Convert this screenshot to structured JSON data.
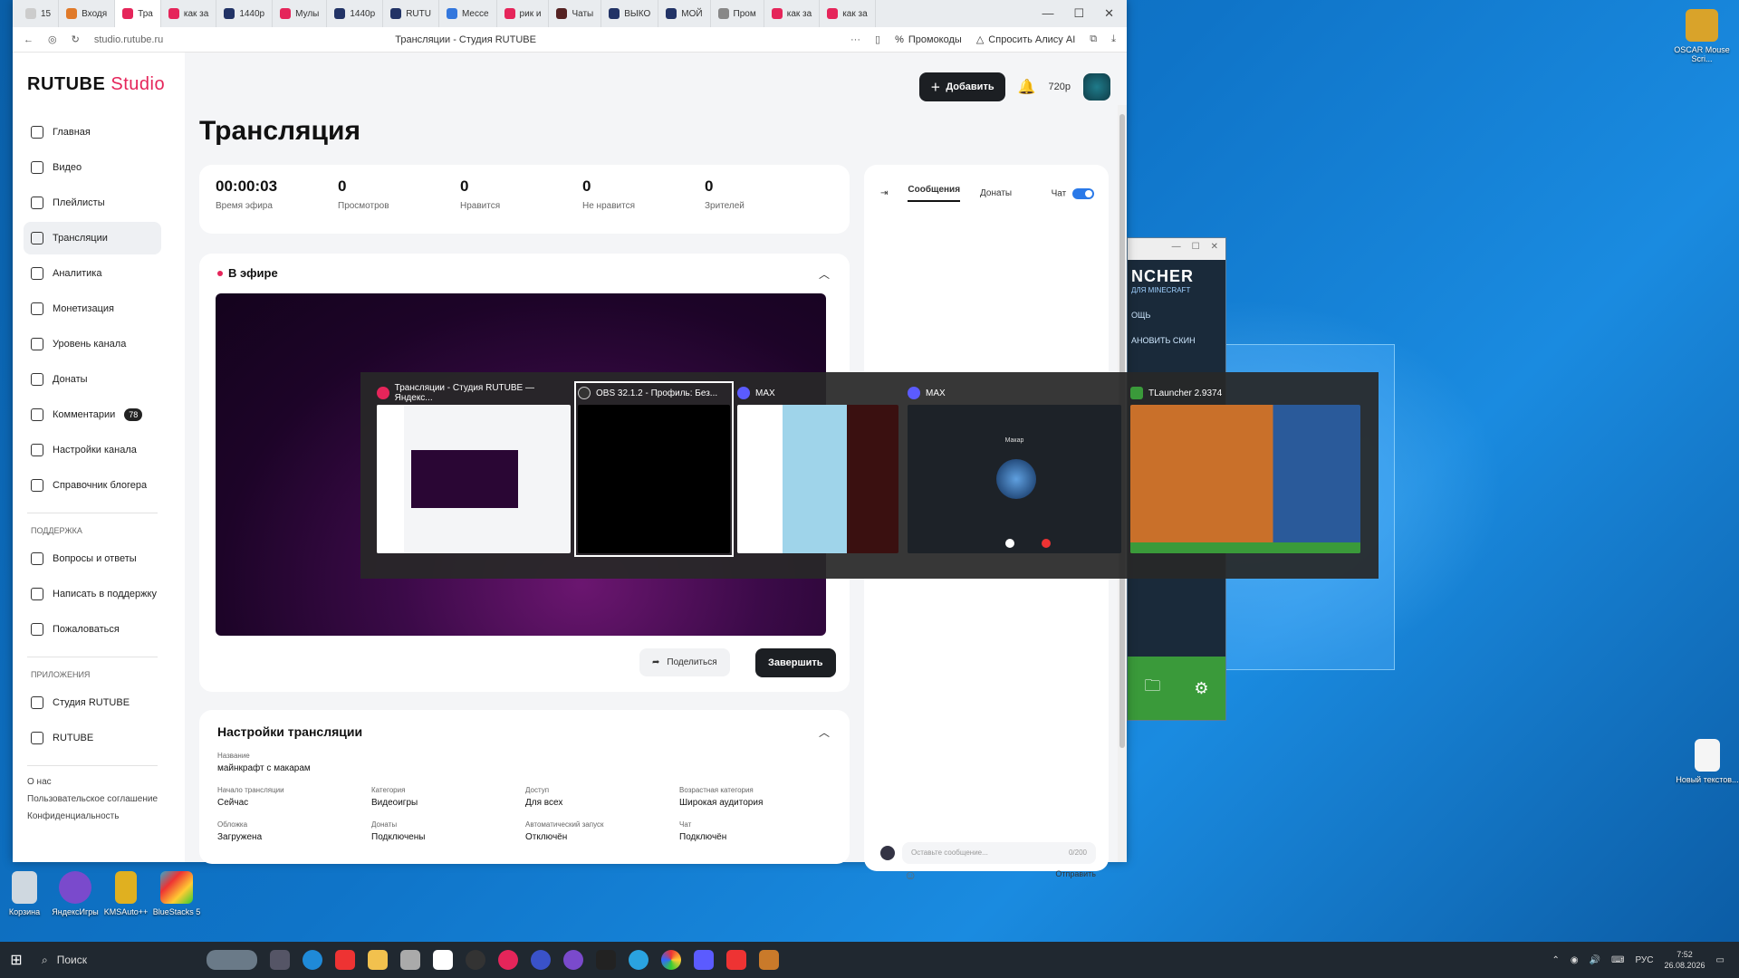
{
  "browser": {
    "tabs": [
      {
        "label": "15",
        "color": "#cccccc"
      },
      {
        "label": "Входя",
        "color": "#e07a2a"
      },
      {
        "label": "Тра",
        "color": "#e5255a",
        "active": true
      },
      {
        "label": "как за",
        "color": "#e5255a"
      },
      {
        "label": "1440p",
        "color": "#223366"
      },
      {
        "label": "Мулы",
        "color": "#e5255a"
      },
      {
        "label": "1440p",
        "color": "#223366"
      },
      {
        "label": "RUTU",
        "color": "#223366"
      },
      {
        "label": "Мессе",
        "color": "#3377dd"
      },
      {
        "label": "рик и",
        "color": "#e5255a"
      },
      {
        "label": "Чаты",
        "color": "#552222"
      },
      {
        "label": "ВЫКО",
        "color": "#223366"
      },
      {
        "label": "МОЙ",
        "color": "#223366"
      },
      {
        "label": "Пром",
        "color": "#888888"
      },
      {
        "label": "как за",
        "color": "#e5255a"
      },
      {
        "label": "как за",
        "color": "#e5255a"
      }
    ],
    "url": "studio.rutube.ru",
    "page_title": "Трансляции - Студия RUTUBE",
    "promo_label": "Промокоды",
    "alice_label": "Спросить Алису AI"
  },
  "logo": {
    "main": "RUTUBE",
    "studio": "Studio"
  },
  "sidebar": {
    "items": [
      {
        "label": "Главная"
      },
      {
        "label": "Видео"
      },
      {
        "label": "Плейлисты"
      },
      {
        "label": "Трансляции",
        "active": true
      },
      {
        "label": "Аналитика"
      },
      {
        "label": "Монетизация"
      },
      {
        "label": "Уровень канала"
      },
      {
        "label": "Донаты"
      },
      {
        "label": "Комментарии",
        "badge": "78"
      },
      {
        "label": "Настройки канала"
      },
      {
        "label": "Справочник блогера"
      }
    ],
    "support_title": "ПОДДЕРЖКА",
    "support": [
      {
        "label": "Вопросы и ответы"
      },
      {
        "label": "Написать в поддержку"
      },
      {
        "label": "Пожаловаться"
      }
    ],
    "apps_title": "ПРИЛОЖЕНИЯ",
    "apps": [
      {
        "label": "Студия RUTUBE"
      },
      {
        "label": "RUTUBE"
      }
    ],
    "footer": [
      "О нас",
      "Пользовательское соглашение",
      "Конфиденциальность"
    ]
  },
  "header": {
    "add_label": "Добавить",
    "quality": "720p"
  },
  "page": {
    "title": "Трансляция"
  },
  "stats": [
    {
      "value": "00:00:03",
      "label": "Время эфира"
    },
    {
      "value": "0",
      "label": "Просмотров"
    },
    {
      "value": "0",
      "label": "Нравится"
    },
    {
      "value": "0",
      "label": "Не нравится"
    },
    {
      "value": "0",
      "label": "Зрителей"
    }
  ],
  "live": {
    "title": "В эфире",
    "share_label": "Поделиться",
    "end_label": "Завершить"
  },
  "settings": {
    "title": "Настройки трансляции",
    "name_key": "Название",
    "name_val": "майнкрафт с макарам",
    "fields": [
      {
        "k": "Начало трансляции",
        "v": "Сейчас"
      },
      {
        "k": "Категория",
        "v": "Видеоигры"
      },
      {
        "k": "Доступ",
        "v": "Для всех"
      },
      {
        "k": "Возрастная категория",
        "v": "Широкая аудитория"
      },
      {
        "k": "Обложка",
        "v": "Загружена"
      },
      {
        "k": "Донаты",
        "v": "Подключены"
      },
      {
        "k": "Автоматический запуск",
        "v": "Отключён"
      },
      {
        "k": "Чат",
        "v": "Подключён"
      }
    ]
  },
  "chat": {
    "tab_messages": "Сообщения",
    "tab_donates": "Донаты",
    "chat_label": "Чат",
    "placeholder": "Оставьте сообщение...",
    "counter": "0/200",
    "send_label": "Отправить"
  },
  "switcher": {
    "items": [
      {
        "label": "Трансляции - Студия RUTUBE — Яндекс...",
        "icon_color": "#e5255a"
      },
      {
        "label": "OBS 32.1.2 - Профиль: Без...",
        "icon_color": "#333333",
        "selected": true
      },
      {
        "label": "MAX",
        "icon_color": "#5b5bff"
      },
      {
        "label": "MAX",
        "icon_color": "#5b5bff",
        "caption": "Макар"
      },
      {
        "label": "TLauncher 2.9374",
        "icon_color": "#3a9a3a"
      }
    ]
  },
  "tlauncher": {
    "logo": "NCHER",
    "sub": "ДЛЯ MINECRAFT",
    "menu1": "ОЩЬ",
    "menu2": "АНОВИТЬ СКИН"
  },
  "desktop": {
    "icons_left": [
      "Корзина",
      "ЯндексИгры",
      "KMSAuto++",
      "BlueStacks 5"
    ],
    "oscar": "OSCAR Mouse Scri...",
    "new_file": "Новый текстов..."
  },
  "taskbar": {
    "search": "Поиск",
    "lang": "РУС",
    "time": "7:52",
    "date": "26.08.2026"
  }
}
